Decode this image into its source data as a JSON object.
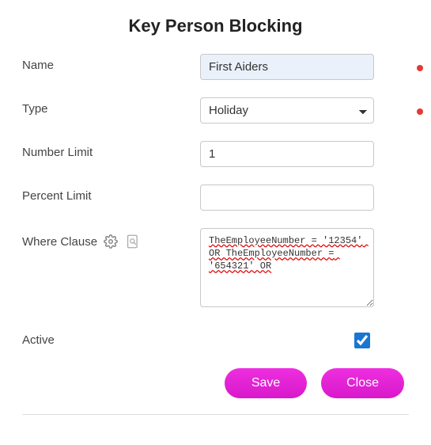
{
  "title": "Key Person Blocking",
  "labels": {
    "name": "Name",
    "type": "Type",
    "number_limit": "Number Limit",
    "percent_limit": "Percent Limit",
    "where_clause": "Where Clause",
    "active": "Active"
  },
  "fields": {
    "name": "First Aiders",
    "type_selected": "Holiday",
    "number_limit": "1",
    "percent_limit": "",
    "where_clause": "TheEmployeeNumber = '12354' OR TheEmployeeNumber = '654321' OR",
    "active": true
  },
  "buttons": {
    "save": "Save",
    "close": "Close"
  }
}
